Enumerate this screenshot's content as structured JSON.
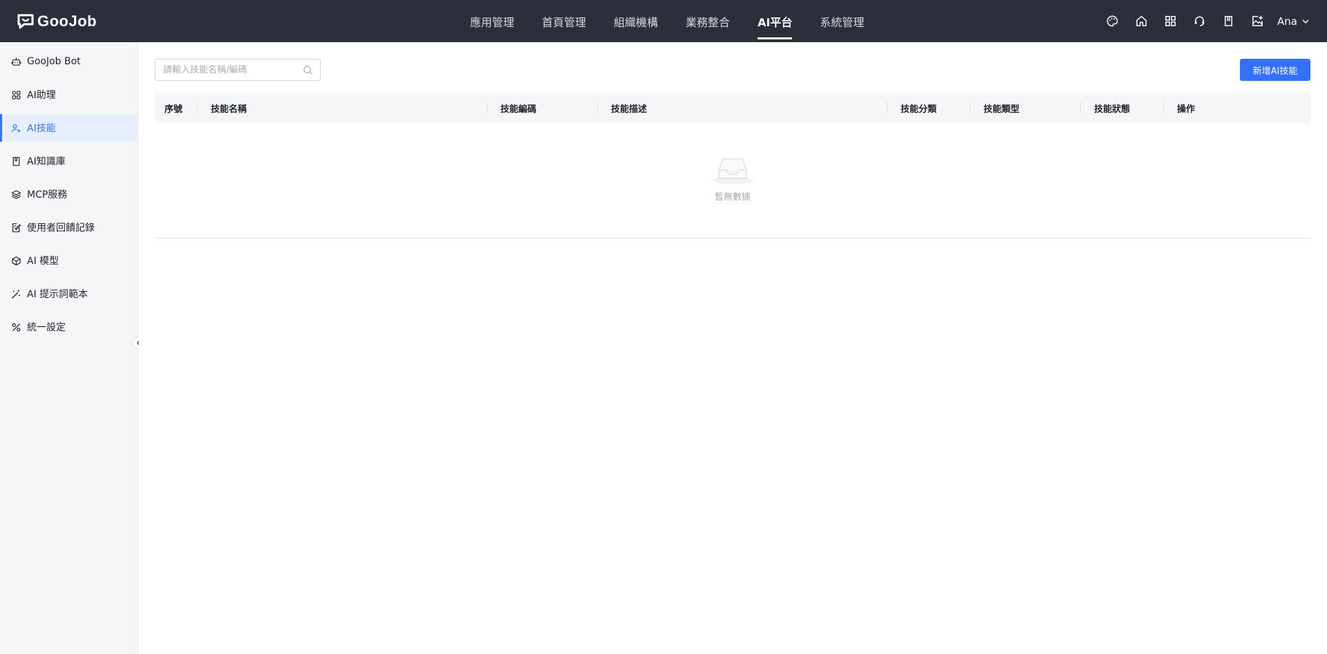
{
  "brand": {
    "name": "GooJob"
  },
  "nav": {
    "items": [
      {
        "label": "應用管理"
      },
      {
        "label": "首頁管理"
      },
      {
        "label": "組織機構"
      },
      {
        "label": "業務整合"
      },
      {
        "label": "AI平台",
        "active": true
      },
      {
        "label": "系統管理"
      }
    ]
  },
  "header": {
    "icons": [
      "palette-icon",
      "home-icon",
      "grid-icon",
      "support-icon",
      "book-icon",
      "image-add-icon"
    ],
    "user": "Ana"
  },
  "sidebar": {
    "items": [
      {
        "label": "GooJob Bot",
        "icon": "bot-icon"
      },
      {
        "label": "AI助理",
        "icon": "apps-icon"
      },
      {
        "label": "AI技能",
        "icon": "skill-icon",
        "active": true
      },
      {
        "label": "AI知識庫",
        "icon": "book-icon"
      },
      {
        "label": "MCP服務",
        "icon": "layers-icon"
      },
      {
        "label": "使用者回饋記錄",
        "icon": "edit-doc-icon"
      },
      {
        "label": "AI 模型",
        "icon": "cube-icon"
      },
      {
        "label": "AI 提示詞範本",
        "icon": "magic-wand-icon"
      },
      {
        "label": "統一設定",
        "icon": "settings-tools-icon"
      }
    ]
  },
  "main": {
    "search": {
      "placeholder": "請輸入技能名稱/編碼",
      "value": ""
    },
    "add_button": "新增AI技能",
    "table": {
      "columns": [
        {
          "label": "序號"
        },
        {
          "label": "技能名稱"
        },
        {
          "label": "技能編碼"
        },
        {
          "label": "技能描述"
        },
        {
          "label": "技能分類"
        },
        {
          "label": "技能類型"
        },
        {
          "label": "技能狀態"
        },
        {
          "label": "操作"
        }
      ],
      "rows": [],
      "empty_text": "暫無數據"
    }
  },
  "colors": {
    "topbar_bg": "#2b2f3a",
    "accent": "#3370ff",
    "sidebar_bg": "#f5f6f8",
    "sidebar_active_bg": "#e7efff"
  }
}
